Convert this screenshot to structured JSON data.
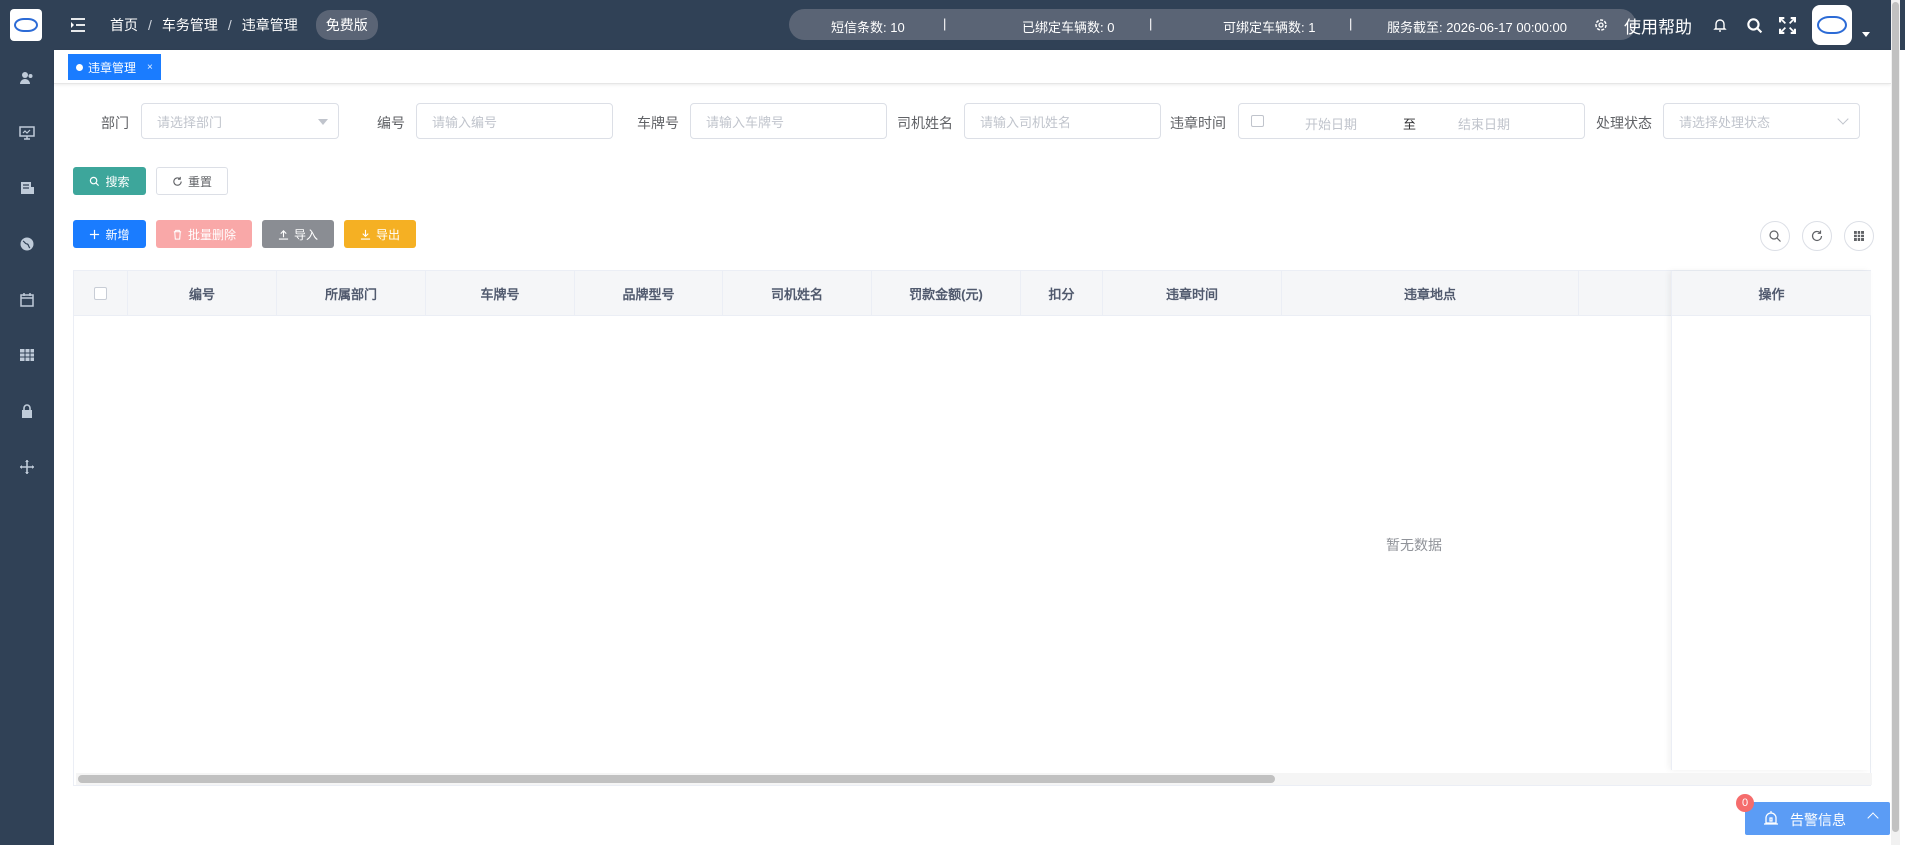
{
  "header": {
    "breadcrumb": [
      "首页",
      "车务管理",
      "违章管理"
    ],
    "breadcrumb_sep": "/",
    "plan_badge": "免费版",
    "stats": {
      "sms_label": "短信条数:",
      "sms_value": "10",
      "bound_label": "已绑定车辆数:",
      "bound_value": "0",
      "bindable_label": "可绑定车辆数:",
      "bindable_value": "1",
      "service_label": "服务截至:",
      "service_value": "2026-06-17 00:00:00",
      "separator": "|"
    },
    "help_label": "使用帮助"
  },
  "tags": [
    {
      "label": "违章管理",
      "close": "×"
    }
  ],
  "search_form": {
    "dept_label": "部门",
    "dept_placeholder": "请选择部门",
    "code_label": "编号",
    "code_placeholder": "请输入编号",
    "plate_label": "车牌号",
    "plate_placeholder": "请输入车牌号",
    "driver_label": "司机姓名",
    "driver_placeholder": "请输入司机姓名",
    "time_label": "违章时间",
    "start_placeholder": "开始日期",
    "range_sep": "至",
    "end_placeholder": "结束日期",
    "status_label": "处理状态",
    "status_placeholder": "请选择处理状态",
    "search_btn": "搜索",
    "reset_btn": "重置"
  },
  "toolbar": {
    "add_btn": "新增",
    "batch_delete_btn": "批量删除",
    "import_btn": "导入",
    "export_btn": "导出"
  },
  "table": {
    "columns": [
      "编号",
      "所属部门",
      "车牌号",
      "品牌型号",
      "司机姓名",
      "罚款金额(元)",
      "扣分",
      "违章时间",
      "违章地点"
    ],
    "action_column": "操作",
    "empty_text": "暂无数据"
  },
  "alarm": {
    "label": "告警信息",
    "count": "0"
  },
  "colors": {
    "nav_bg": "#304156",
    "primary": "#1a7cff",
    "search_btn": "#3da69b",
    "batch_delete_btn": "#f9a8a8",
    "import_btn": "#8a8d93",
    "export_btn": "#f5b023"
  },
  "icons": {
    "sidebar": [
      "user-icon",
      "monitor-icon",
      "doc-icon",
      "globe-icon",
      "calendar-icon",
      "table-icon",
      "lock-icon",
      "move-icon"
    ],
    "header": [
      "hamburger-icon",
      "gear-icon",
      "bell-icon",
      "search-icon",
      "fullscreen-icon"
    ]
  }
}
